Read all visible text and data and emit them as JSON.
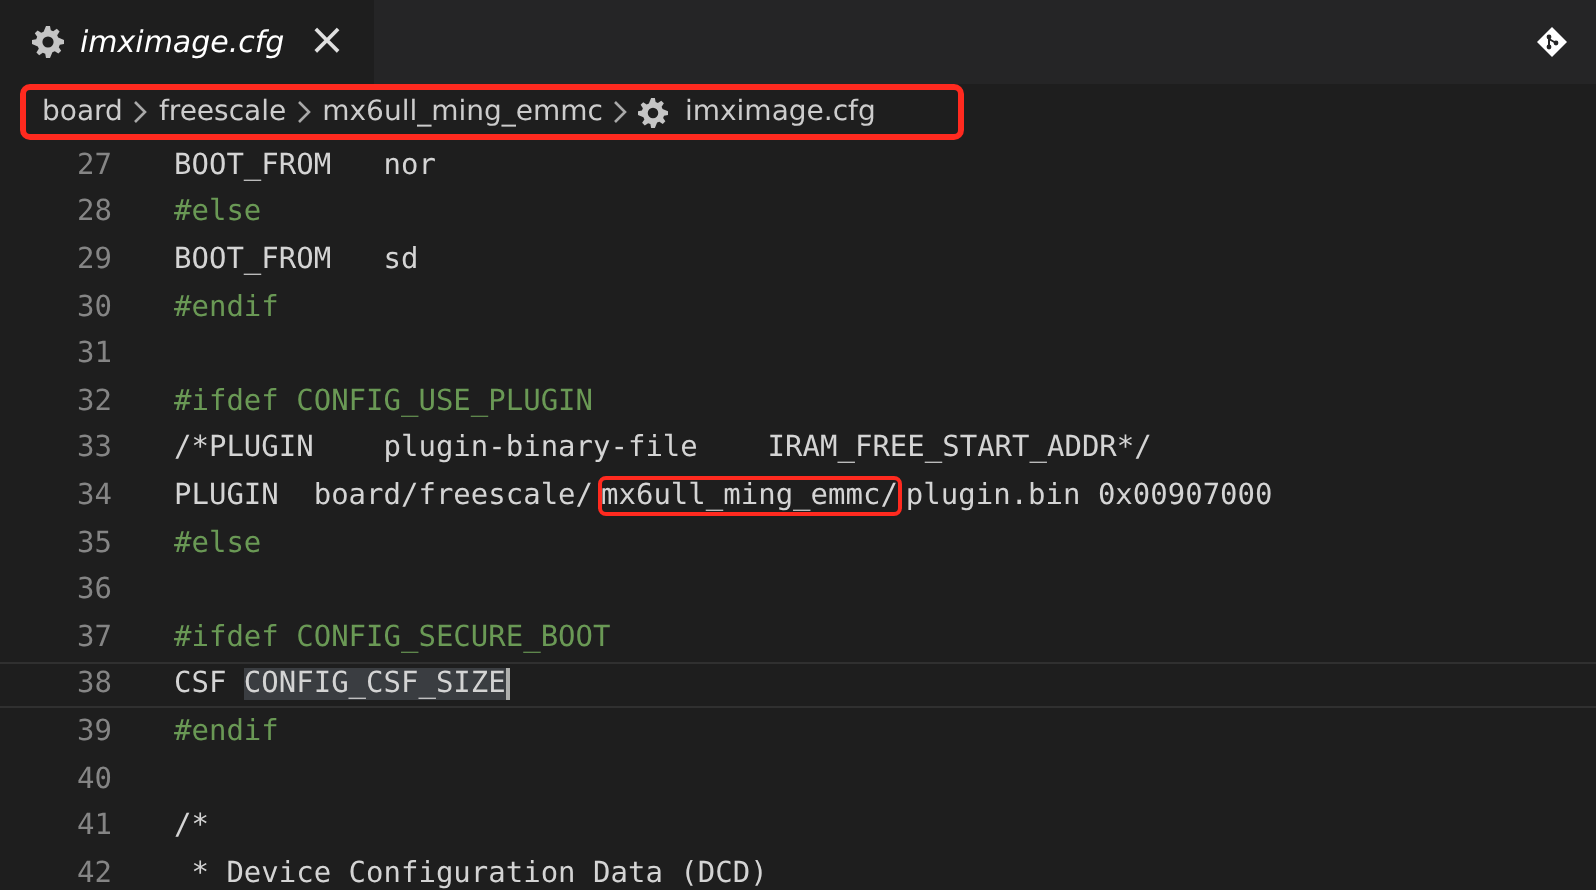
{
  "tab": {
    "title": "imximage.cfg",
    "selected": true,
    "close": "×"
  },
  "breadcrumb": {
    "highlighted": true,
    "items": [
      {
        "label": "board",
        "kind": "folder"
      },
      {
        "label": "freescale",
        "kind": "folder"
      },
      {
        "label": "mx6ull_ming_emmc",
        "kind": "folder"
      },
      {
        "label": "imximage.cfg",
        "kind": "file"
      }
    ]
  },
  "lines": [
    {
      "number": "27",
      "current": false,
      "tokens": [
        {
          "text": "BOOT_FROM   nor",
          "kind": "plain"
        }
      ]
    },
    {
      "number": "28",
      "current": false,
      "tokens": [
        {
          "text": "#else",
          "kind": "directive"
        }
      ]
    },
    {
      "number": "29",
      "current": false,
      "tokens": [
        {
          "text": "BOOT_FROM   sd",
          "kind": "plain"
        }
      ]
    },
    {
      "number": "30",
      "current": false,
      "tokens": [
        {
          "text": "#endif",
          "kind": "directive"
        }
      ]
    },
    {
      "number": "31",
      "current": false
    },
    {
      "number": "32",
      "current": false,
      "tokens": [
        {
          "text": "#ifdef CONFIG_USE_PLUGIN",
          "kind": "directive"
        }
      ]
    },
    {
      "number": "33",
      "current": false,
      "tokens": [
        {
          "text": "/*PLUGIN    plugin-binary-file    IRAM_FREE_START_ADDR*/",
          "kind": "plain"
        }
      ]
    },
    {
      "number": "34",
      "current": false,
      "tokens": [
        {
          "text": "PLUGIN  board/freescale/",
          "kind": "plain"
        },
        {
          "text": "mx6ull_ming_emmc/",
          "kind": "boxed"
        },
        {
          "text": "plugin.bin 0x00907000",
          "kind": "plain"
        }
      ]
    },
    {
      "number": "35",
      "current": false,
      "tokens": [
        {
          "text": "#else",
          "kind": "directive"
        }
      ]
    },
    {
      "number": "36",
      "current": false
    },
    {
      "number": "37",
      "current": false,
      "tokens": [
        {
          "text": "#ifdef CONFIG_SECURE_BOOT",
          "kind": "directive"
        }
      ]
    },
    {
      "number": "38",
      "current": true,
      "tokens": [
        {
          "text": "CSF ",
          "kind": "plain"
        },
        {
          "text": "CONFIG_CSF_SIZE",
          "kind": "selected"
        }
      ]
    },
    {
      "number": "39",
      "current": false,
      "tokens": [
        {
          "text": "#endif",
          "kind": "directive"
        }
      ]
    },
    {
      "number": "40",
      "current": false
    },
    {
      "number": "41",
      "current": false,
      "tokens": [
        {
          "text": "/*",
          "kind": "plain"
        }
      ]
    },
    {
      "number": "42",
      "current": false,
      "tokens": [
        {
          "text": " * Device Configuration Data (DCD)",
          "kind": "plain"
        }
      ]
    }
  ]
}
